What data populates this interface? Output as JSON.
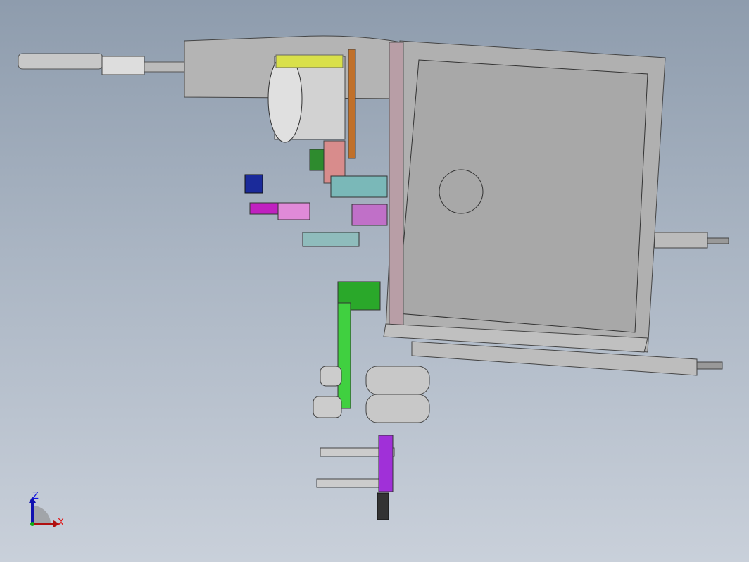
{
  "viewport": {
    "background_top": "#8e9cad",
    "background_bottom": "#c9d0da"
  },
  "triad": {
    "z_label": "Z",
    "x_label": "X",
    "z_color": "#1010e0",
    "x_color": "#e01010"
  }
}
